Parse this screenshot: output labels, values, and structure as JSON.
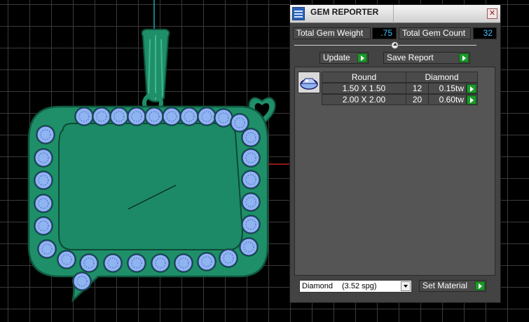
{
  "panel": {
    "title": "GEM REPORTER",
    "close_glyph": "✕",
    "total_weight_label": "Total Gem Weight",
    "total_weight_value": ".75",
    "total_count_label": "Total Gem Count",
    "total_count_value": "32",
    "update_label": "Update",
    "save_report_label": "Save Report",
    "table": {
      "headers": [
        "Round",
        "Diamond"
      ],
      "rows": [
        {
          "size": "1.50 X 1.50",
          "count": "12",
          "weight": "0.15tw"
        },
        {
          "size": "2.00 X 2.00",
          "count": "20",
          "weight": "0.60tw"
        }
      ]
    },
    "material": {
      "name": "Diamond",
      "spg": "(3.52 spg)"
    },
    "set_material_label": "Set Material"
  },
  "colors": {
    "metal": "#1f8f6a",
    "metal_dark": "#0e5a40",
    "gem": "#8fb4f2",
    "value_text": "#3ec5ff",
    "play_button": "#1c9b2b"
  },
  "icons": [
    "gem-reporter-icon",
    "close-icon",
    "slider-knob-icon",
    "play-arrow-icon",
    "gem-thumbnail-icon",
    "dropdown-arrow-icon",
    "heart-charm-icon"
  ]
}
